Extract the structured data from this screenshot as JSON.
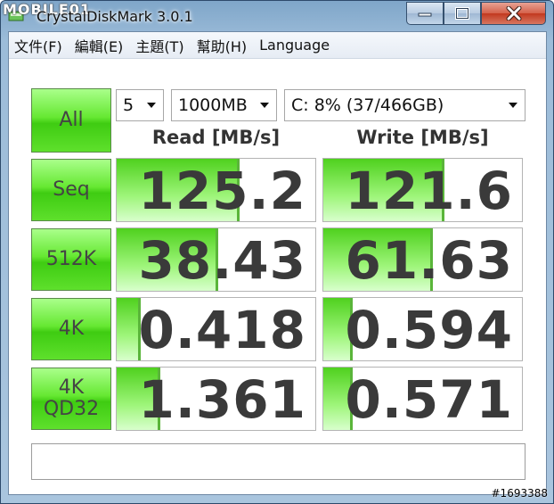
{
  "watermark": "MOBILE01",
  "window": {
    "title": "CrystalDiskMark 3.0.1"
  },
  "menu": [
    "文件(F)",
    "編輯(E)",
    "主題(T)",
    "幫助(H)",
    "Language"
  ],
  "controls": {
    "all_label": "All",
    "count": "5",
    "size": "1000MB",
    "drive": "C: 8% (37/466GB)"
  },
  "headers": {
    "read": "Read [MB/s]",
    "write": "Write [MB/s]"
  },
  "tests": [
    {
      "label": "Seq",
      "read": "125.2",
      "write": "121.6",
      "read_fill": 0.62,
      "write_fill": 0.61
    },
    {
      "label": "512K",
      "read": "38.43",
      "write": "61.63",
      "read_fill": 0.51,
      "write_fill": 0.55
    },
    {
      "label": "4K",
      "read": "0.418",
      "write": "0.594",
      "read_fill": 0.12,
      "write_fill": 0.15
    },
    {
      "label": "4K\nQD32",
      "read": "1.361",
      "write": "0.571",
      "read_fill": 0.22,
      "write_fill": 0.15
    }
  ],
  "comment": "",
  "serial": "#1693388",
  "colors": {
    "green": "#66e832",
    "bar": "#9ef57a"
  }
}
